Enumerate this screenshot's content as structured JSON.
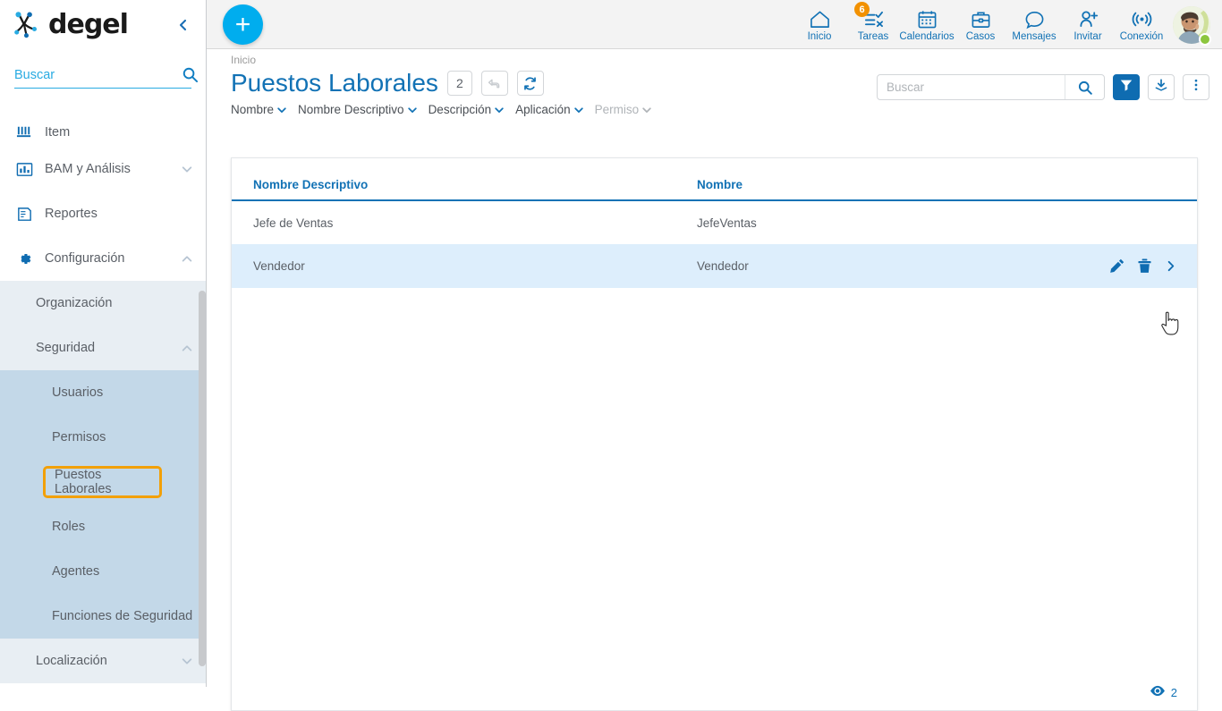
{
  "brand": {
    "name": "degel",
    "collapse_icon": "chevron-left-icon"
  },
  "sidebar": {
    "search": {
      "placeholder": "Buscar",
      "value": "",
      "icon": "search-icon"
    },
    "items": [
      {
        "label": "Item",
        "icon": "item-icon",
        "chevron": ""
      },
      {
        "label": "BAM y Análisis",
        "icon": "bar-chart-icon",
        "chevron": "chevron-down-icon"
      },
      {
        "label": "Reportes",
        "icon": "report-icon",
        "chevron": ""
      },
      {
        "label": "Configuración",
        "icon": "gear-icon",
        "chevron": "chevron-up-icon"
      }
    ],
    "config_children": [
      {
        "label": "Organización",
        "chevron": ""
      },
      {
        "label": "Seguridad",
        "chevron": "chevron-up-icon"
      }
    ],
    "seguridad_children": [
      {
        "label": "Usuarios",
        "selected": false
      },
      {
        "label": "Permisos",
        "selected": false
      },
      {
        "label": "Puestos Laborales",
        "selected": true
      },
      {
        "label": "Roles",
        "selected": false
      },
      {
        "label": "Agentes",
        "selected": false
      },
      {
        "label": "Funciones de Seguridad",
        "selected": false
      }
    ],
    "footer_items": [
      {
        "label": "Localización",
        "chevron": "chevron-down-icon"
      }
    ],
    "highlight_color": "#f2a007"
  },
  "topbar": {
    "add_button": {
      "label": "+",
      "icon": "plus-icon",
      "color": "#00adee"
    },
    "icons": [
      {
        "label": "Inicio",
        "icon": "home-icon",
        "badge": ""
      },
      {
        "label": "Tareas",
        "icon": "tasks-icon",
        "badge": "6"
      },
      {
        "label": "Calendarios",
        "icon": "calendar-icon",
        "badge": ""
      },
      {
        "label": "Casos",
        "icon": "briefcase-icon",
        "badge": ""
      },
      {
        "label": "Mensajes",
        "icon": "chat-bubble-icon",
        "badge": ""
      },
      {
        "label": "Invitar",
        "icon": "user-add-icon",
        "badge": ""
      },
      {
        "label": "Conexión",
        "icon": "broadcast-icon",
        "badge": ""
      }
    ],
    "badge_color": "#f29100",
    "avatar": {
      "name": "avatar",
      "status": "online",
      "status_color": "#8cc63e"
    }
  },
  "main": {
    "breadcrumb": "Inicio",
    "title": "Puestos Laborales",
    "count": "2",
    "undo_button": {
      "icon": "undo-icon",
      "disabled": true
    },
    "refresh_button": {
      "icon": "refresh-icon",
      "disabled": false
    },
    "chips": [
      {
        "label": "Nombre",
        "dim": false
      },
      {
        "label": "Nombre Descriptivo",
        "dim": false
      },
      {
        "label": "Descripción",
        "dim": false
      },
      {
        "label": "Aplicación",
        "dim": false
      },
      {
        "label": "Permiso",
        "dim": true
      }
    ],
    "search": {
      "placeholder": "Buscar",
      "value": "",
      "icon": "search-icon"
    },
    "tools": [
      {
        "name": "filter-button",
        "icon": "funnel-icon",
        "active": true
      },
      {
        "name": "download-button",
        "icon": "download-icon",
        "active": false
      },
      {
        "name": "more-options-button",
        "icon": "kebab-menu-icon",
        "active": false
      }
    ],
    "collapse_handle_icon": "chevron-up-icon",
    "table": {
      "columns": [
        "Nombre Descriptivo",
        "Nombre"
      ],
      "rows": [
        {
          "nombre_descriptivo": "Jefe de Ventas",
          "nombre": "JefeVentas",
          "hovered": false
        },
        {
          "nombre_descriptivo": "Vendedor",
          "nombre": "Vendedor",
          "hovered": true
        }
      ],
      "row_actions": [
        {
          "name": "edit-row-button",
          "icon": "pencil-icon"
        },
        {
          "name": "delete-row-button",
          "icon": "trash-icon"
        },
        {
          "name": "open-row-button",
          "icon": "chevron-right-icon"
        }
      ]
    },
    "view_count": {
      "icon": "eye-icon",
      "value": "2"
    }
  },
  "colors": {
    "primary_blue": "#1272b5",
    "accent_cyan": "#00adee",
    "highlight_orange": "#f2a007",
    "row_hover": "#ddeefc",
    "sub_panel": "#e8eef3",
    "sub2_panel": "#c3d8e8"
  }
}
